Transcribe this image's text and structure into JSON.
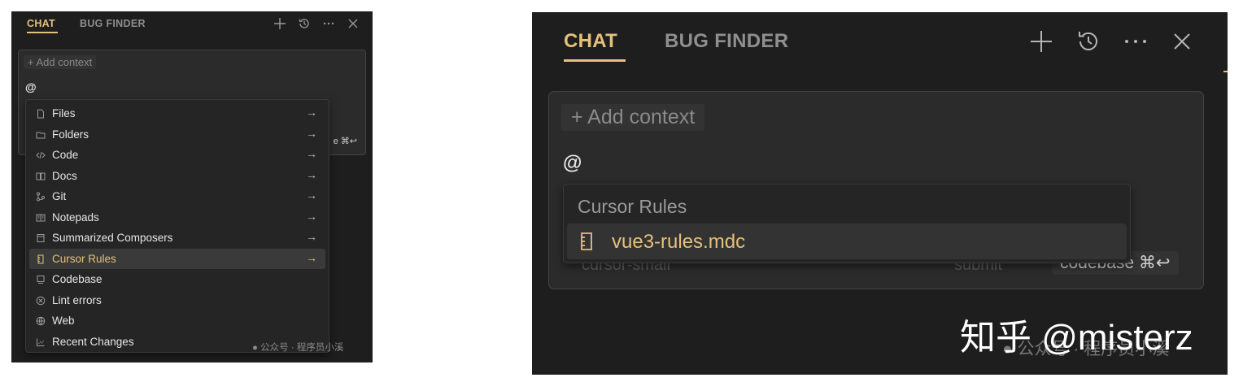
{
  "header": {
    "tab_chat": "CHAT",
    "tab_bug_finder": "BUG FINDER",
    "icons": [
      "plus-icon",
      "history-icon",
      "ellipsis-icon",
      "close-icon"
    ]
  },
  "composer": {
    "add_context": "+ Add context",
    "at_symbol": "@",
    "model_hint": "cursor-small",
    "submit_hint": "submit",
    "codebase_hint": "codebase ⌘↩",
    "codebase_hint_short": "e ⌘↩"
  },
  "mention_menu": {
    "items": [
      {
        "label": "Files",
        "icon": "file-icon"
      },
      {
        "label": "Folders",
        "icon": "folder-icon"
      },
      {
        "label": "Code",
        "icon": "code-icon"
      },
      {
        "label": "Docs",
        "icon": "book-icon"
      },
      {
        "label": "Git",
        "icon": "git-icon"
      },
      {
        "label": "Notepads",
        "icon": "notepad-icon"
      },
      {
        "label": "Summarized Composers",
        "icon": "composer-icon"
      },
      {
        "label": "Cursor Rules",
        "icon": "ruler-icon"
      },
      {
        "label": "Codebase",
        "icon": "codebase-icon"
      },
      {
        "label": "Lint errors",
        "icon": "lint-icon"
      },
      {
        "label": "Web",
        "icon": "globe-icon"
      },
      {
        "label": "Recent Changes",
        "icon": "changes-icon"
      }
    ],
    "arrow": "→",
    "selected_index": 7
  },
  "rules_menu": {
    "header": "Cursor Rules",
    "item": "vue3-rules.mdc"
  },
  "watermarks": {
    "wechat": "公众号 · 程序员小溪",
    "zhihu": "知乎 @misterz"
  },
  "colors": {
    "accent": "#e5c07b",
    "panel_bg": "#1e1e1e",
    "menu_bg": "#252526"
  }
}
